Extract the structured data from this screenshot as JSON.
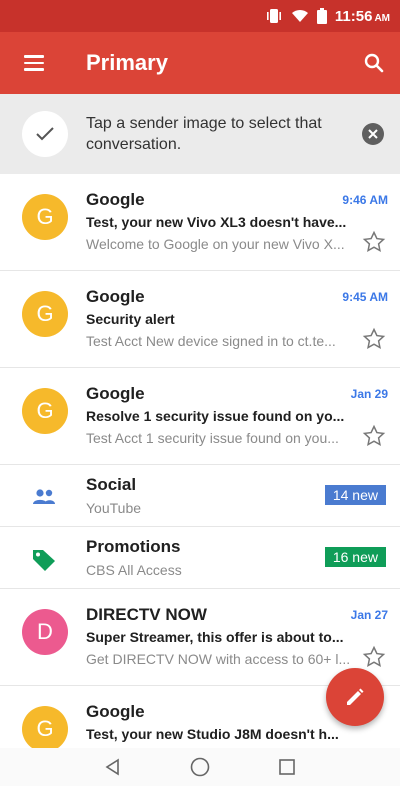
{
  "status_bar": {
    "time": "11:56",
    "ampm": "AM",
    "icons": [
      "vibrate-icon",
      "wifi-icon",
      "battery-icon"
    ]
  },
  "app_bar": {
    "title": "Primary",
    "color": "#db4437",
    "icons": [
      "menu-icon",
      "search-icon"
    ]
  },
  "tip": {
    "text": "Tap a sender image to select that conversation."
  },
  "colors": {
    "accent_red": "#db4437",
    "status_red": "#c7322b",
    "time_blue": "#3b78e7",
    "social_blue": "#4a7bd0",
    "promo_green": "#0f9d58",
    "avatar_yellow": "#f6b92b",
    "avatar_pink": "#ec5a8f"
  },
  "emails": [
    {
      "avatar_letter": "G",
      "sender": "Google",
      "time": "9:46 AM",
      "subject": "Test, your new Vivo XL3 doesn't have...",
      "snippet": "Welcome to Google on your new Vivo X..."
    },
    {
      "avatar_letter": "G",
      "sender": "Google",
      "time": "9:45 AM",
      "subject": "Security alert",
      "snippet": "Test Acct New device signed in to ct.te..."
    },
    {
      "avatar_letter": "G",
      "sender": "Google",
      "time": "Jan 29",
      "subject": "Resolve 1 security issue found on yo...",
      "snippet": "Test Acct 1 security issue found on you..."
    }
  ],
  "categories": [
    {
      "name": "Social",
      "sub": "YouTube",
      "badge": "14 new",
      "icon": "people-icon"
    },
    {
      "name": "Promotions",
      "sub": "CBS All Access",
      "badge": "16 new",
      "icon": "tag-icon"
    }
  ],
  "emails_more": [
    {
      "avatar_letter": "D",
      "sender": "DIRECTV NOW",
      "time": "Jan 27",
      "subject": "Super Streamer, this offer is about to...",
      "snippet": "Get DIRECTV NOW with access to 60+ l..."
    },
    {
      "avatar_letter": "G",
      "sender": "Google",
      "subject": "Test, your new Studio J8M doesn't h..."
    }
  ],
  "fab": {
    "icon": "pencil-icon"
  },
  "nav_bar": {
    "icons": [
      "back-icon",
      "home-icon",
      "recents-icon"
    ]
  }
}
